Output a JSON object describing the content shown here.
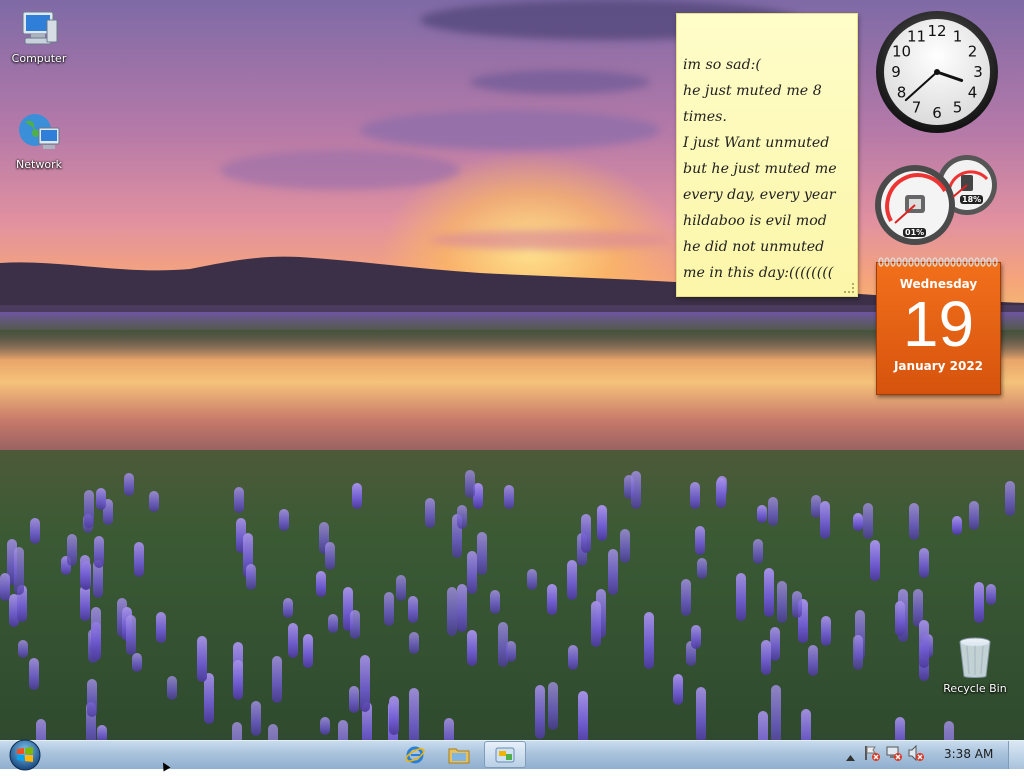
{
  "desktop": {
    "icons": [
      {
        "label": "Computer",
        "icon": "computer-icon"
      },
      {
        "label": "Network",
        "icon": "network-icon"
      },
      {
        "label": "Recycle Bin",
        "icon": "recycle-bin-icon"
      }
    ]
  },
  "sticky_note": {
    "lines": [
      "im so sad:(",
      "he just muted me 8",
      "times.",
      "I just Want unmuted",
      "but he just muted me",
      "every day, every year",
      "hildaboo is evil mod",
      "he did not unmuted",
      "me in this day:(((((((("
    ]
  },
  "clock": {
    "numerals": [
      "12",
      "1",
      "2",
      "3",
      "4",
      "5",
      "6",
      "7",
      "8",
      "9",
      "10",
      "11"
    ],
    "time": "3:38"
  },
  "cpu_meter": {
    "cpu_percent": "01%",
    "memory_percent": "18%"
  },
  "calendar": {
    "weekday": "Wednesday",
    "day": "19",
    "month_year": "January 2022"
  },
  "taskbar": {
    "start_icon": "windows-start-orb-icon",
    "pinned": [
      {
        "name": "internet-explorer-icon"
      },
      {
        "name": "windows-explorer-icon"
      },
      {
        "name": "gadgets-icon",
        "active": true
      }
    ],
    "tray": {
      "overflow": "chevron-up-icon",
      "icons": [
        "action-center-flag-icon",
        "network-status-icon",
        "volume-muted-icon"
      ],
      "clock": "3:38 AM"
    }
  },
  "colors": {
    "calendar_orange": "#e9620f",
    "sticky_yellow": "#fdf9b4",
    "taskbar_blue": "#a9c3dc"
  }
}
